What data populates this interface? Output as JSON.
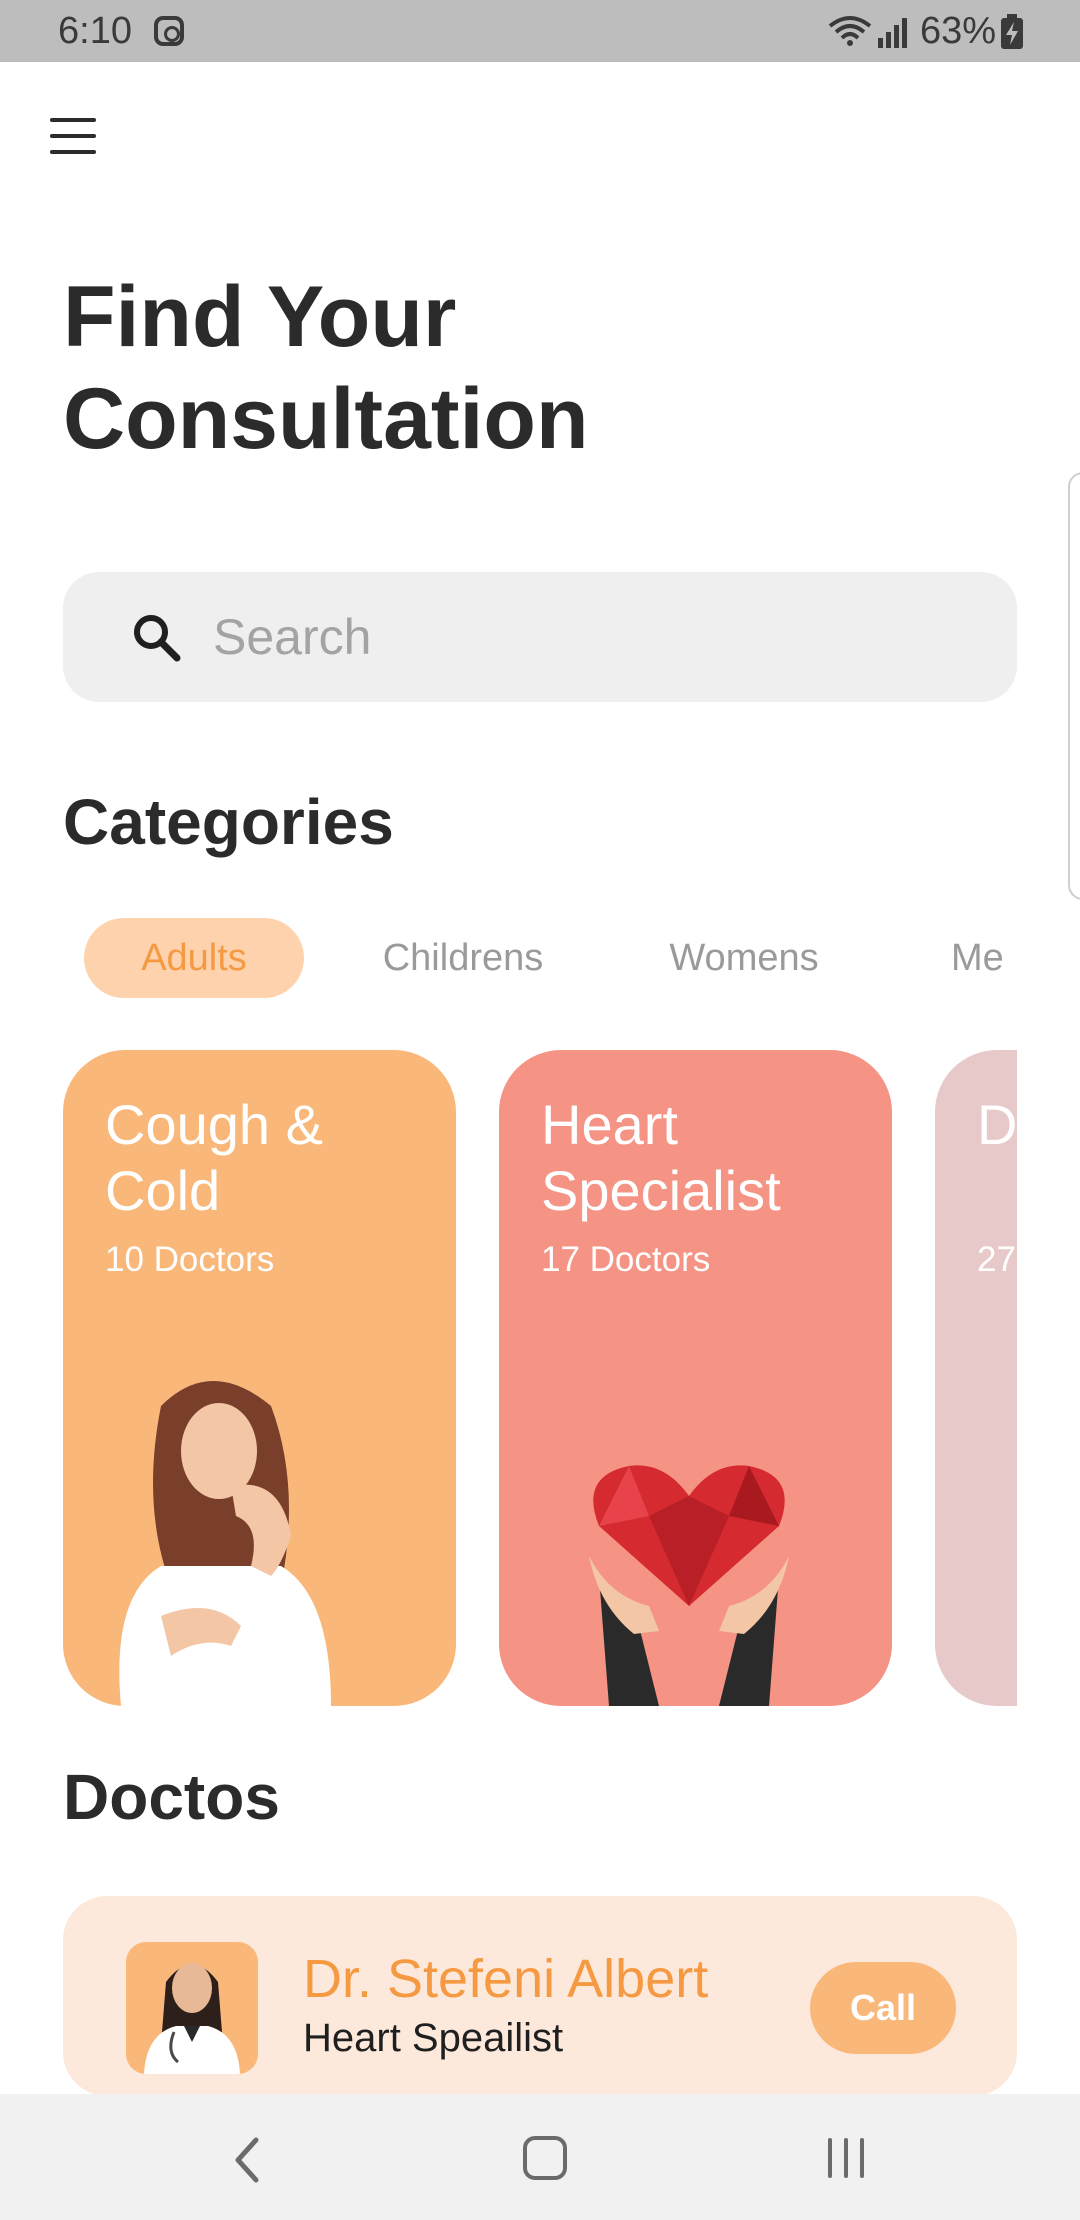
{
  "status_bar": {
    "time": "6:10",
    "battery": "63%",
    "icons": [
      "instagram-icon",
      "wifi-icon",
      "signal-icon",
      "battery-charging-icon"
    ]
  },
  "header": {
    "menu_icon": "hamburger-menu-icon",
    "title_line1": "Find Your",
    "title_line2": "Consultation"
  },
  "search": {
    "placeholder": "Search",
    "value": "",
    "icon": "search-icon"
  },
  "categories": {
    "heading": "Categories",
    "tabs": [
      {
        "label": "Adults",
        "active": true
      },
      {
        "label": "Childrens",
        "active": false
      },
      {
        "label": "Womens",
        "active": false
      },
      {
        "label": "Me",
        "active": false
      }
    ],
    "cards": [
      {
        "title": "Cough & Cold",
        "subtitle": "10 Doctors",
        "color": "#f9b87a"
      },
      {
        "title": "Heart Specialist",
        "subtitle": "17 Doctors",
        "color": "#f59384"
      },
      {
        "title": "D C",
        "subtitle": "27",
        "color": "#e8c9c9"
      }
    ]
  },
  "doctors": {
    "heading": "Doctos",
    "items": [
      {
        "name": "Dr. Stefeni Albert",
        "specialty": "Heart Speailist",
        "call_label": "Call"
      }
    ]
  },
  "colors": {
    "accent": "#f59a42",
    "accent_light": "#fdd2ad",
    "card_orange": "#f9b87a",
    "card_coral": "#f59384",
    "doctor_bg": "#fde9db"
  },
  "nav_bar": {
    "icons": [
      "back-icon",
      "home-icon",
      "recent-apps-icon"
    ]
  }
}
